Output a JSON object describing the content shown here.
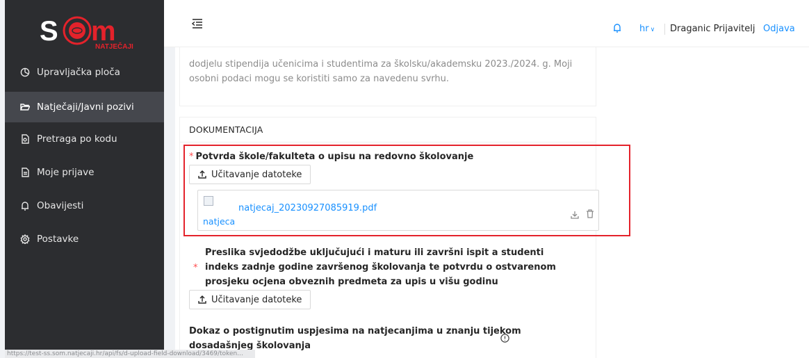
{
  "logo": {
    "text": "NATJEČAJI"
  },
  "sidebar": {
    "items": [
      {
        "label": "Upravljačka ploča",
        "icon": "dashboard-icon"
      },
      {
        "label": "Natječaji/Javni pozivi",
        "icon": "folder-open-icon",
        "active": true
      },
      {
        "label": "Pretraga po kodu",
        "icon": "file-search-icon"
      },
      {
        "label": "Moje prijave",
        "icon": "file-text-icon"
      },
      {
        "label": "Obavijesti",
        "icon": "bell-icon"
      },
      {
        "label": "Postavke",
        "icon": "gear-icon"
      }
    ]
  },
  "header": {
    "language": "hr",
    "user_name": "Draganic Prijavitelj",
    "logout_label": "Odjava"
  },
  "consent": {
    "text": "dodjelu stipendija učenicima i studentima za školsku/akademsku 2023./2024. g. Moji osobni podaci mogu se koristiti samo za navedenu svrhu."
  },
  "documentation": {
    "title": "DOKUMENTACIJA",
    "upload_label": "Učitavanje datoteke",
    "fields": [
      {
        "label": "Potvrda škole/fakulteta o upisu na redovno školovanje",
        "required": true,
        "file": {
          "name": "natjecaj_20230927085919.pdf",
          "thumb_alt": "natjecaj_20230927085919.pdf"
        }
      },
      {
        "label_lines": [
          "Preslika svjedodžbe uključujući i maturu ili završni ispit a studenti",
          "indeks zadnje godine završenog školovanja te potvrdu o ostvarenom",
          "prosjeku ocjena obveznih predmeta za upis u višu godinu"
        ],
        "required": true
      },
      {
        "label_lines": [
          "Dokaz o postignutim uspjesima na natjecanjima u znanju tijekom",
          "dosadašnjeg školovanja"
        ],
        "required": false
      }
    ]
  },
  "status_bar": {
    "url": "https://test-ss.som.natjecaji.hr/api/fs/d-upload-field-download/3469/token..."
  },
  "colors": {
    "accent": "#1890ff",
    "highlight": "#e4222b",
    "sidebar_bg": "#2c2d30",
    "logo_red": "#e4222b"
  }
}
